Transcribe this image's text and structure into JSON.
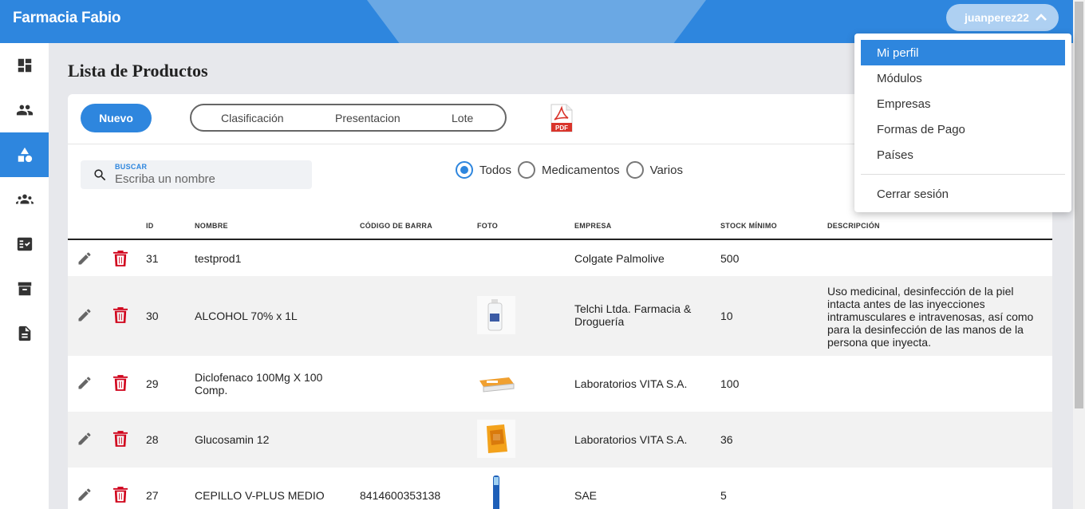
{
  "app": {
    "brand": "Farmacia Fabio",
    "username": "juanperez22"
  },
  "sidebar": {
    "items": [
      {
        "name": "dashboard-icon",
        "active": false
      },
      {
        "name": "people-icon",
        "active": false
      },
      {
        "name": "category-icon",
        "active": true
      },
      {
        "name": "groups-icon",
        "active": false
      },
      {
        "name": "fact-check-icon",
        "active": false
      },
      {
        "name": "archive-icon",
        "active": false
      },
      {
        "name": "document-icon",
        "active": false
      }
    ]
  },
  "page": {
    "title": "Lista de Productos"
  },
  "toolbar": {
    "nuevo_label": "Nuevo",
    "segments": [
      "Clasificación",
      "Presentacion",
      "Lote"
    ],
    "pdf_icon": "pdf-icon"
  },
  "search": {
    "label": "BUSCAR",
    "placeholder": "Escriba un nombre",
    "value": ""
  },
  "filters": {
    "options": [
      "Todos",
      "Medicamentos",
      "Varios"
    ],
    "selected": "Todos"
  },
  "table": {
    "columns": [
      "ID",
      "NOMBRE",
      "CÓDIGO DE BARRA",
      "FOTO",
      "EMPRESA",
      "STOCK MÍNIMO",
      "DESCRIPCIÓN"
    ],
    "rows": [
      {
        "id": "31",
        "nombre": "testprod1",
        "codigo": "",
        "foto": "",
        "empresa": "Colgate Palmolive",
        "stock": "500",
        "descripcion": ""
      },
      {
        "id": "30",
        "nombre": "ALCOHOL 70% x 1L",
        "codigo": "",
        "foto": "alcohol-bottle",
        "empresa": "Telchi Ltda. Farmacia & Droguería",
        "stock": "10",
        "descripcion": "Uso medicinal, desinfección de la piel intacta antes de las inyecciones intramusculares e intravenosas, así como para la desinfección de las manos de la persona que inyecta."
      },
      {
        "id": "29",
        "nombre": "Diclofenaco 100Mg X 100 Comp.",
        "codigo": "",
        "foto": "pill-box",
        "empresa": "Laboratorios VITA S.A.",
        "stock": "100",
        "descripcion": ""
      },
      {
        "id": "28",
        "nombre": "Glucosamin 12",
        "codigo": "",
        "foto": "supplement-box",
        "empresa": "Laboratorios VITA S.A.",
        "stock": "36",
        "descripcion": ""
      },
      {
        "id": "27",
        "nombre": "CEPILLO V-PLUS MEDIO",
        "codigo": "8414600353138",
        "foto": "toothbrush",
        "empresa": "SAE",
        "stock": "5",
        "descripcion": ""
      }
    ]
  },
  "user_menu": {
    "items": [
      "Mi perfil",
      "Módulos",
      "Empresas",
      "Formas de Pago",
      "Países"
    ],
    "active": "Mi perfil",
    "logout": "Cerrar sesión"
  },
  "colors": {
    "primary": "#2e86de",
    "danger": "#d0021b",
    "row_alt": "#f2f2f2"
  }
}
